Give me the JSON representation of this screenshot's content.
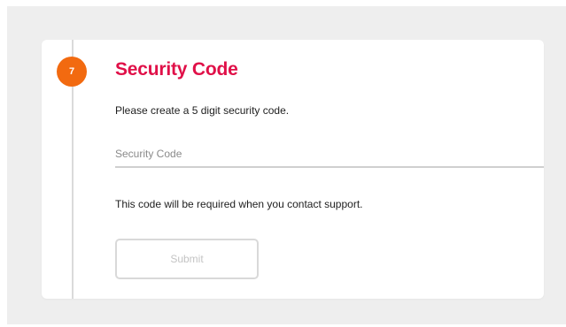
{
  "step": {
    "number": "7",
    "title": "Security Code"
  },
  "instruction": "Please create a 5 digit security code.",
  "security_code_field": {
    "placeholder": "Security Code",
    "value": ""
  },
  "support_note": "This code will be required when you contact support.",
  "submit": {
    "label": "Submit",
    "enabled": false
  },
  "colors": {
    "step_badge": "#f26a10",
    "title": "#e01048",
    "backdrop": "#eeeeee"
  }
}
